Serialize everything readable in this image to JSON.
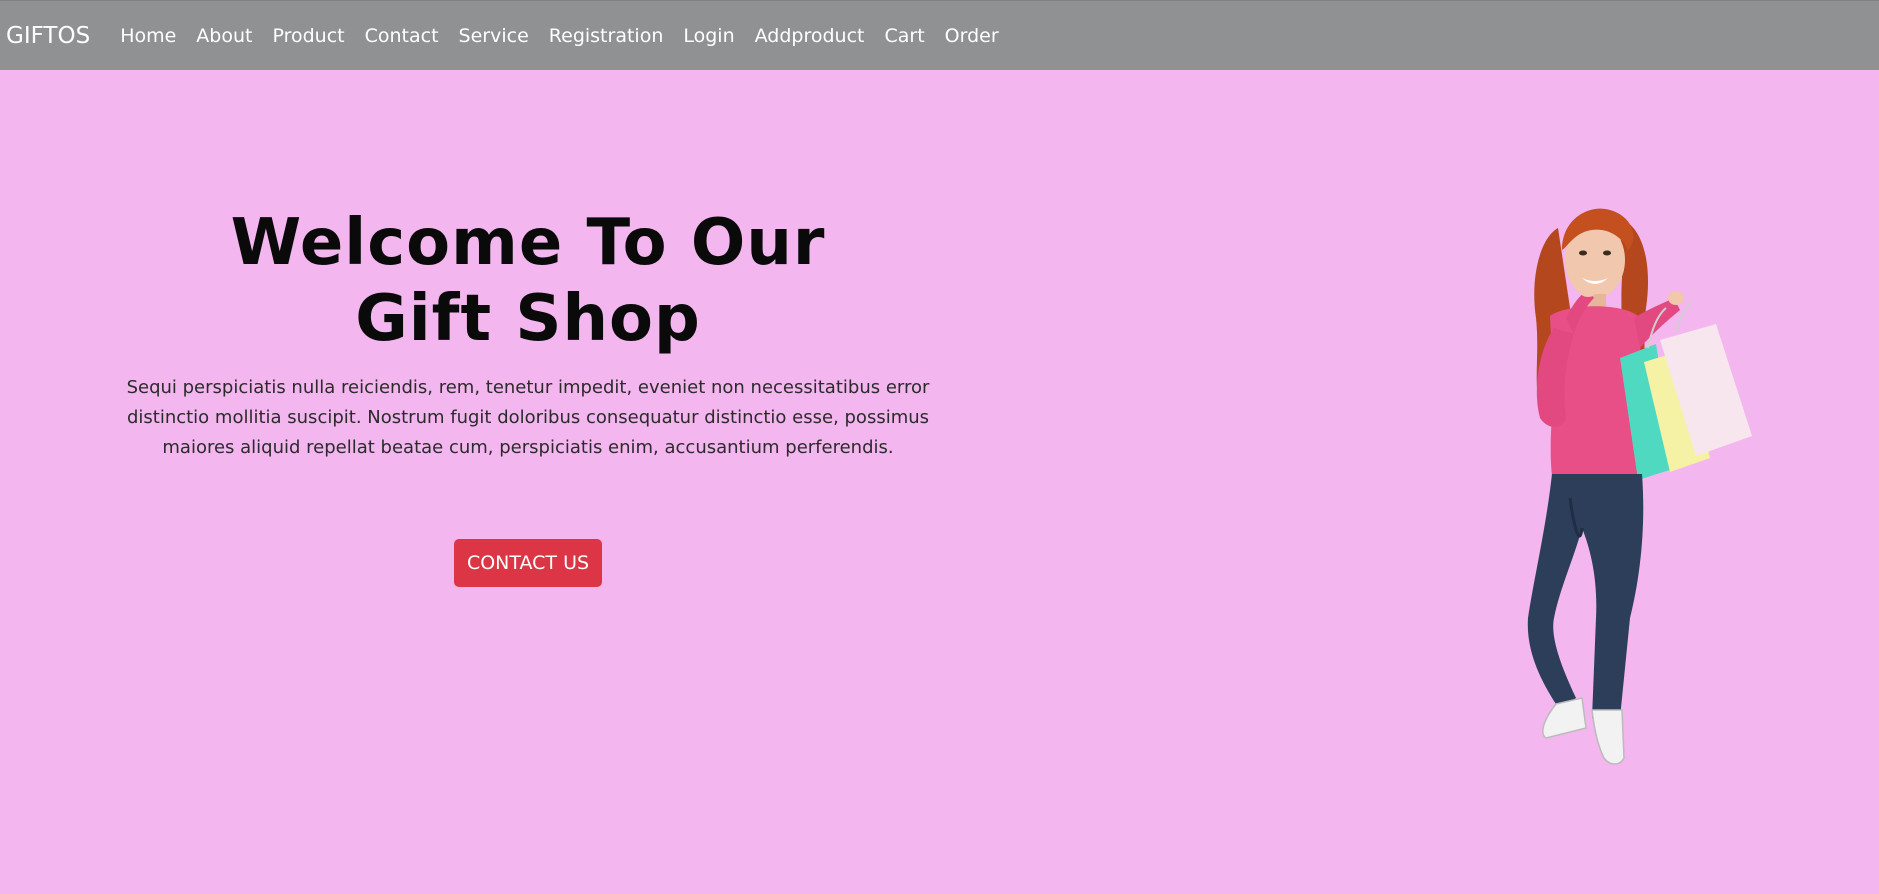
{
  "navbar": {
    "brand": "GIFTOS",
    "links": [
      "Home",
      "About",
      "Product",
      "Contact",
      "Service",
      "Registration",
      "Login",
      "Addproduct",
      "Cart",
      "Order"
    ]
  },
  "hero": {
    "title_line1": "Welcome To Our",
    "title_line2": "Gift Shop",
    "description": "Sequi perspiciatis nulla reiciendis, rem, tenetur impedit, eveniet non necessitatibus error distinctio mollitia suscipit. Nostrum fugit doloribus consequatur distinctio esse, possimus maiores aliquid repellat beatae cum, perspiciatis enim, accusantium perferendis.",
    "cta_label": "CONTACT US",
    "image_icon": "woman-with-shopping-bags-image"
  },
  "colors": {
    "navbar_bg": "#8f9193",
    "page_bg": "#f3b6ee",
    "cta_bg": "#dc3545"
  }
}
